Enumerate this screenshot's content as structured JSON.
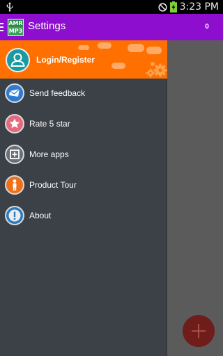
{
  "status_bar": {
    "time": "3:23 PM",
    "icons": [
      "usb-icon",
      "do-not-disturb-icon",
      "battery-charging-icon"
    ]
  },
  "app_bar": {
    "logo_top": "AMR",
    "logo_bottom": "MP3",
    "title": "Settings",
    "badge_count": "0",
    "colors": {
      "background": "#8e0ed0"
    }
  },
  "drawer": {
    "header": {
      "label": "Login/Register",
      "avatar_icon": "user-avatar-icon",
      "colors": {
        "background": "#ff7000",
        "avatar": "#1a9aa3"
      }
    },
    "items": [
      {
        "label": "Send feedback",
        "icon": "envelope-icon",
        "color": "#2e7bd1"
      },
      {
        "label": "Rate 5 star",
        "icon": "star-icon",
        "color": "#e56a7d"
      },
      {
        "label": "More apps",
        "icon": "plus-box-icon",
        "color": "#6a6e76"
      },
      {
        "label": "Product Tour",
        "icon": "person-icon",
        "color": "#f0701a"
      },
      {
        "label": "About",
        "icon": "info-icon",
        "color": "#2f7bb8"
      }
    ]
  },
  "fab": {
    "icon": "plus-icon",
    "color": "#6e1d1a"
  }
}
